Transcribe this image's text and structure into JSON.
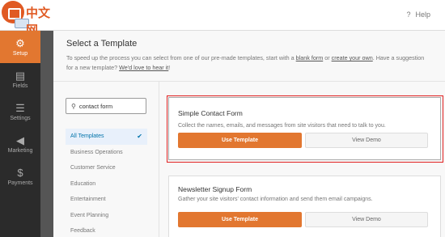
{
  "header": {
    "logo_text": "中文网",
    "help_label": "Help"
  },
  "sidebar": {
    "items": [
      {
        "label": "Setup",
        "icon": "gear-icon",
        "glyph": "⚙"
      },
      {
        "label": "Fields",
        "icon": "fields-icon",
        "glyph": "▤"
      },
      {
        "label": "Settings",
        "icon": "sliders-icon",
        "glyph": "☰"
      },
      {
        "label": "Marketing",
        "icon": "megaphone-icon",
        "glyph": "📣"
      },
      {
        "label": "Payments",
        "icon": "dollar-icon",
        "glyph": "$"
      }
    ],
    "active": "Setup"
  },
  "main": {
    "title": "Select a Template",
    "intro_part1": "To speed up the process you can select from one of our pre-made templates, start with a ",
    "blank_form_link": "blank form",
    "intro_or": " or ",
    "create_own_link": "create your own",
    "intro_part2": ". Have a suggestion for a new template? ",
    "love_to_hear_link": "We'd love to hear it",
    "intro_end": "!"
  },
  "search": {
    "value": "contact form"
  },
  "categories": [
    "All Templates",
    "Business Operations",
    "Customer Service",
    "Education",
    "Entertainment",
    "Event Planning",
    "Feedback"
  ],
  "active_category": "All Templates",
  "templates": [
    {
      "title": "Simple Contact Form",
      "description": "Collect the names, emails, and messages from site visitors that need to talk to you.",
      "use_label": "Use Template",
      "demo_label": "View Demo"
    },
    {
      "title": "Newsletter Signup Form",
      "description": "Gather your site visitors' contact information and send them email campaigns.",
      "use_label": "Use Template",
      "demo_label": "View Demo"
    }
  ],
  "colors": {
    "accent": "#e27730",
    "sidebar_bg": "#2b2b2b",
    "highlight": "#e02020",
    "link": "#0073aa"
  }
}
